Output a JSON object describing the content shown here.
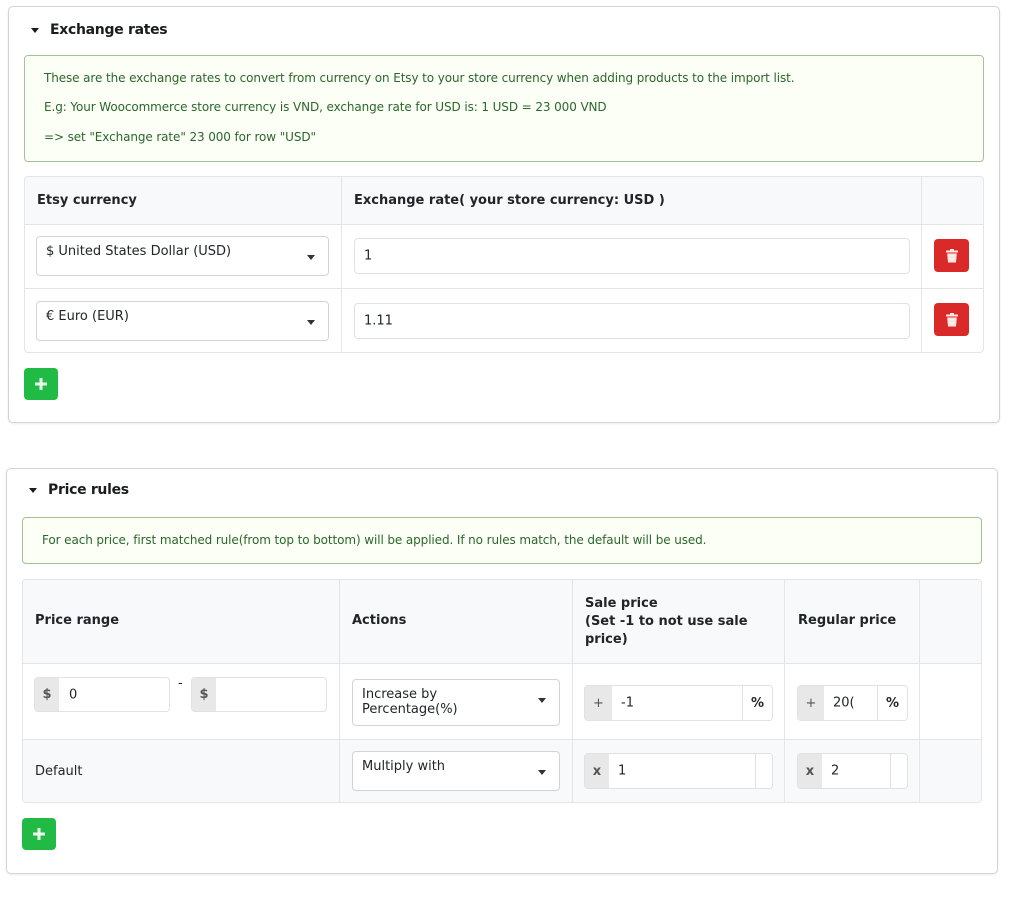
{
  "exchange_rates": {
    "title": "Exchange rates",
    "notice": [
      "These are the exchange rates to convert from currency on Etsy to your store currency when adding products to the import list.",
      "E.g: Your Woocommerce store currency is VND, exchange rate for USD is: 1 USD = 23 000 VND",
      "=> set \"Exchange rate\" 23 000 for row \"USD\""
    ],
    "columns": [
      "Etsy currency",
      "Exchange rate( your store currency: USD )",
      ""
    ],
    "rows": [
      {
        "currency": "$ United States Dollar (USD)",
        "rate": "1"
      },
      {
        "currency": "€ Euro (EUR)",
        "rate": "1.11"
      }
    ],
    "add_button_icon": "plus-icon",
    "delete_button_icon": "trash-icon"
  },
  "price_rules": {
    "title": "Price rules",
    "notice": "For each price, first matched rule(from top to bottom) will be applied. If no rules match, the default will be used.",
    "columns": {
      "price_range": "Price range",
      "actions": "Actions",
      "sale_price_line1": "Sale price",
      "sale_price_line2": "(Set -1 to not use sale",
      "sale_price_line3": "price)",
      "regular_price": "Regular price"
    },
    "rule_row": {
      "from_prefix": "$",
      "from_value": "0",
      "separator": "-",
      "to_prefix": "$",
      "to_value": "",
      "action_line1": "Increase by",
      "action_line2": "Percentage(%)",
      "sale_prefix": "+",
      "sale_value": "-1",
      "sale_suffix": "%",
      "regular_prefix": "+",
      "regular_value": "20(",
      "regular_suffix": "%"
    },
    "default_row": {
      "label": "Default",
      "action": "Multiply with",
      "sale_prefix": "x",
      "sale_value": "1",
      "regular_prefix": "x",
      "regular_value": "2"
    },
    "add_button_icon": "plus-icon"
  },
  "colors": {
    "notice_bg": "#fcfff5",
    "notice_border": "#a3c293",
    "notice_text": "#2c662d",
    "delete_red": "#db2828",
    "add_green": "#21ba45"
  }
}
